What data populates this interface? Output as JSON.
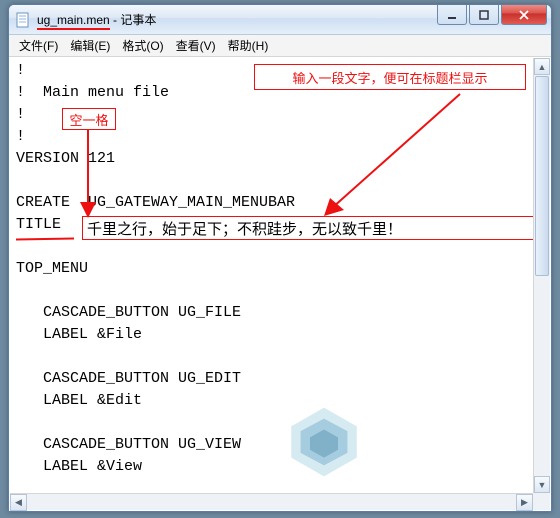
{
  "titlebar": {
    "filename": "ug_main.men",
    "sep": " - ",
    "app": "记事本"
  },
  "menubar": {
    "file": "文件(F)",
    "edit": "编辑(E)",
    "format": "格式(O)",
    "view": "查看(V)",
    "help": "帮助(H)"
  },
  "document": {
    "lines": [
      "!",
      "!  Main menu file",
      "!",
      "!",
      "VERSION 121",
      "",
      "CREATE  UG_GATEWAY_MAIN_MENUBAR",
      "TITLE",
      "",
      "TOP_MENU",
      "",
      "   CASCADE_BUTTON UG_FILE",
      "   LABEL &File",
      "",
      "   CASCADE_BUTTON UG_EDIT",
      "   LABEL &Edit",
      "",
      "   CASCADE_BUTTON UG_VIEW",
      "   LABEL &View"
    ],
    "title_value": "千里之行，始于足下；不积跬步，无以致千里！"
  },
  "annotations": {
    "tip": "输入一段文字，便可在标题栏显示",
    "space": "空一格"
  }
}
